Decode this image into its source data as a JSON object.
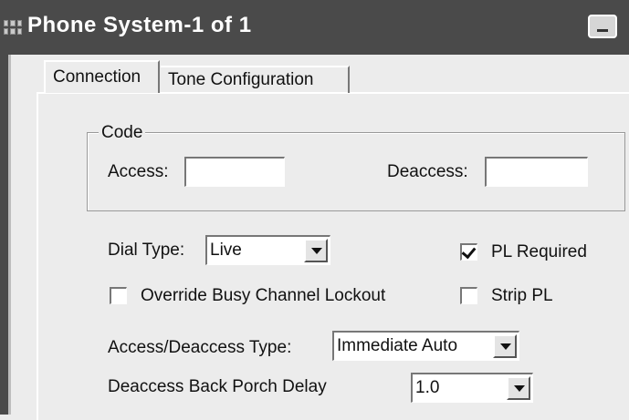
{
  "window": {
    "title": "Phone System-1 of 1",
    "icon": "grid-app-icon",
    "minimize_icon": "minimize-icon"
  },
  "tabs": [
    {
      "label": "Connection",
      "active": true
    },
    {
      "label": "Tone Configuration",
      "active": false
    }
  ],
  "code_group": {
    "legend": "Code",
    "access_label": "Access:",
    "access_value": "",
    "deaccess_label": "Deaccess:",
    "deaccess_value": ""
  },
  "dial_type": {
    "label": "Dial Type:",
    "value": "Live"
  },
  "checkboxes": {
    "pl_required": {
      "label": "PL Required",
      "checked": true
    },
    "override_busy": {
      "label": "Override Busy Channel Lockout",
      "checked": false
    },
    "strip_pl": {
      "label": "Strip PL",
      "checked": false
    }
  },
  "access_deaccess_type": {
    "label": "Access/Deaccess Type:",
    "value": "Immediate Auto"
  },
  "back_porch_delay": {
    "label": "Deaccess Back Porch Delay",
    "value": "1.0"
  }
}
